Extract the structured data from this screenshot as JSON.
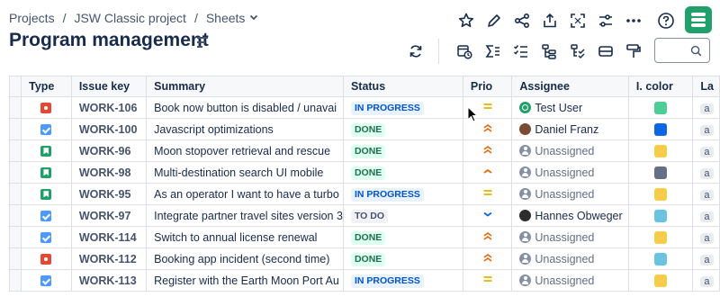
{
  "breadcrumb": {
    "items": [
      "Projects",
      "JSW Classic project",
      "Sheets"
    ],
    "separator": "/"
  },
  "page_title": "Program management",
  "top_icons": [
    "star-icon",
    "edit-icon",
    "share-icon",
    "export-icon",
    "fullscreen-icon",
    "settings-sliders-icon",
    "more-icon",
    "help-icon",
    "app-logo-icon"
  ],
  "toolbar_icons": [
    "refresh-icon",
    "calendar-status-icon",
    "sum-icon",
    "checklist-icon",
    "hierarchy-icon",
    "filter-hierarchy-icon",
    "card-view-icon",
    "paint-format-icon",
    "search-icon"
  ],
  "colors": {
    "accent": "#22a06b",
    "in_progress_bg": "#e9f2ff",
    "in_progress_fg": "#0055cc",
    "done_bg": "#dcfff1",
    "done_fg": "#216e4e",
    "todo_bg": "#f1f2f4",
    "todo_fg": "#44546f"
  },
  "table": {
    "columns": [
      "Type",
      "Issue key",
      "Summary",
      "Status",
      "Prio",
      "Assignee",
      "I. color",
      "La"
    ],
    "rows": [
      {
        "type": "bug",
        "type_color": "#e34935",
        "key": "WORK-106",
        "summary": "Book now button is disabled / unavai",
        "status": "IN PROGRESS",
        "status_style": "inprogress",
        "prio": "medium",
        "assignee": "Test User",
        "avatar": "tu",
        "color": "#4bce97",
        "label": "a"
      },
      {
        "type": "task",
        "type_color": "#4c9aff",
        "key": "WORK-100",
        "summary": "Javascript optimizations",
        "status": "DONE",
        "status_style": "done",
        "prio": "high",
        "assignee": "Daniel Franz",
        "avatar": "df",
        "color": "#0c66e4",
        "label": "a"
      },
      {
        "type": "story",
        "type_color": "#22a06b",
        "key": "WORK-96",
        "summary": "Moon stopover retrieval and rescue",
        "status": "DONE",
        "status_style": "done",
        "prio": "high",
        "assignee": "Unassigned",
        "avatar": "unassigned",
        "color": "#f5cd47",
        "label": "a"
      },
      {
        "type": "story",
        "type_color": "#22a06b",
        "key": "WORK-98",
        "summary": "Multi-destination search UI mobile",
        "status": "DONE",
        "status_style": "done",
        "prio": "medium-high",
        "assignee": "Unassigned",
        "avatar": "unassigned",
        "color": "#626f86",
        "label": "a"
      },
      {
        "type": "story",
        "type_color": "#22a06b",
        "key": "WORK-95",
        "summary": "As an operator I want to have a turbo",
        "status": "IN PROGRESS",
        "status_style": "inprogress",
        "prio": "medium",
        "assignee": "Unassigned",
        "avatar": "unassigned",
        "color": "#f5cd47",
        "label": "a"
      },
      {
        "type": "task",
        "type_color": "#4c9aff",
        "key": "WORK-97",
        "summary": "Integrate partner travel sites version 3",
        "status": "TO DO",
        "status_style": "todo",
        "prio": "low",
        "assignee": "Hannes Obweger",
        "avatar": "ho",
        "color": "#6cc3e0",
        "label": "a"
      },
      {
        "type": "task",
        "type_color": "#4c9aff",
        "key": "WORK-114",
        "summary": "Switch to annual license renewal",
        "status": "DONE",
        "status_style": "done",
        "prio": "high",
        "assignee": "Unassigned",
        "avatar": "unassigned",
        "color": "#f5cd47",
        "label": "a"
      },
      {
        "type": "bug",
        "type_color": "#e34935",
        "key": "WORK-112",
        "summary": "Booking app incident (second time)",
        "status": "DONE",
        "status_style": "done",
        "prio": "high",
        "assignee": "Unassigned",
        "avatar": "unassigned",
        "color": "#6cc3e0",
        "label": "a"
      },
      {
        "type": "task",
        "type_color": "#4c9aff",
        "key": "WORK-113",
        "summary": "Register with the Earth Moon Port Au",
        "status": "IN PROGRESS",
        "status_style": "inprogress",
        "prio": "medium",
        "assignee": "Unassigned",
        "avatar": "unassigned",
        "color": "#f5cd47",
        "label": "a"
      }
    ]
  }
}
